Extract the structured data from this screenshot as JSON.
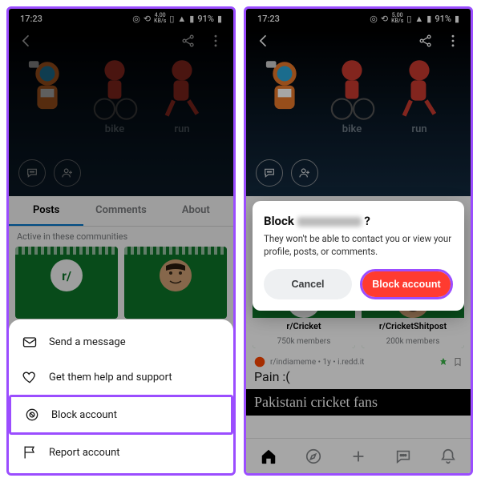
{
  "status": {
    "time": "17:23",
    "battery": "91%",
    "net1": "4.00",
    "net2": "5.00",
    "netunit": "KB/s"
  },
  "header": {
    "labels": [
      "",
      "bike",
      "run"
    ]
  },
  "tabs": {
    "posts": "Posts",
    "comments": "Comments",
    "about": "About"
  },
  "section": {
    "active_label": "Active in these communities"
  },
  "communities": [
    {
      "name": "r/Cricket",
      "members": "750k members",
      "avatar_text": "r/"
    },
    {
      "name": "r/CricketShitpost",
      "members": "200k members",
      "avatar_text": ""
    }
  ],
  "post": {
    "meta": "r/indiameme • 1y • i.redd.it",
    "title": "Pain :(",
    "banner": "Pakistani cricket fans"
  },
  "sheet": {
    "send": "Send a message",
    "help": "Get them help and support",
    "block": "Block account",
    "report": "Report account"
  },
  "modal": {
    "title_prefix": "Block",
    "title_suffix": "?",
    "body": "They won't be able to contact you or view your profile, posts, or comments.",
    "cancel": "Cancel",
    "confirm": "Block account"
  },
  "colors": {
    "accent": "#9b4dff",
    "danger": "#ff3b30",
    "tab_active": "#0079d3"
  }
}
